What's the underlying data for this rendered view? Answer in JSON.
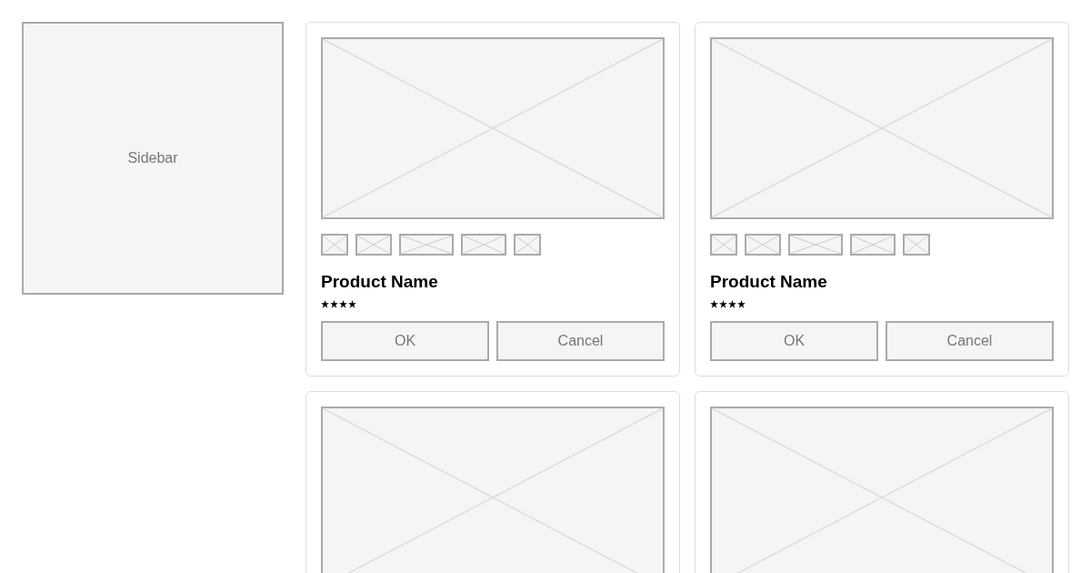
{
  "sidebar": {
    "label": "Sidebar"
  },
  "cards": [
    {
      "kind": "product",
      "title": "Product Name",
      "stars": 4,
      "buttons": [
        "OK",
        "Cancel"
      ]
    },
    {
      "kind": "product",
      "title": "Product Name",
      "stars": 4,
      "buttons": [
        "OK",
        "Cancel"
      ]
    },
    {
      "kind": "image_only"
    },
    {
      "kind": "image_only"
    }
  ]
}
